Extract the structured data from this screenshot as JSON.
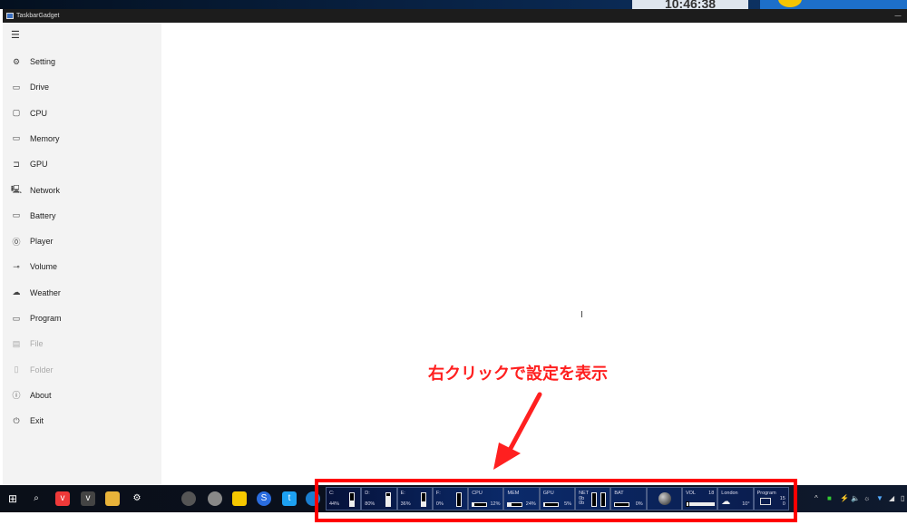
{
  "window": {
    "title": "TaskbarGadget",
    "minimize": "—"
  },
  "desktop": {
    "clock": "10:46:38"
  },
  "sidebar": {
    "menu_icon": "hamburger-icon",
    "items": [
      {
        "label": "Setting",
        "icon": "gear-icon",
        "glyph": "⚙",
        "enabled": true
      },
      {
        "label": "Drive",
        "icon": "drive-icon",
        "glyph": "▭",
        "enabled": true
      },
      {
        "label": "CPU",
        "icon": "cpu-icon",
        "glyph": "▢",
        "enabled": true
      },
      {
        "label": "Memory",
        "icon": "memory-icon",
        "glyph": "▭",
        "enabled": true
      },
      {
        "label": "GPU",
        "icon": "gpu-icon",
        "glyph": "⊐",
        "enabled": true
      },
      {
        "label": "Network",
        "icon": "network-icon",
        "glyph": "🖳",
        "enabled": true
      },
      {
        "label": "Battery",
        "icon": "battery-icon",
        "glyph": "▭",
        "enabled": true
      },
      {
        "label": "Player",
        "icon": "player-icon",
        "glyph": "⓪",
        "enabled": true
      },
      {
        "label": "Volume",
        "icon": "volume-icon",
        "glyph": "⊸",
        "enabled": true
      },
      {
        "label": "Weather",
        "icon": "weather-icon",
        "glyph": "☁",
        "enabled": true
      },
      {
        "label": "Program",
        "icon": "program-icon",
        "glyph": "▭",
        "enabled": true
      },
      {
        "label": "File",
        "icon": "file-icon",
        "glyph": "▤",
        "enabled": false
      },
      {
        "label": "Folder",
        "icon": "folder-icon",
        "glyph": "▯",
        "enabled": false
      },
      {
        "label": "About",
        "icon": "info-icon",
        "glyph": "ⓘ",
        "enabled": true
      },
      {
        "label": "Exit",
        "icon": "power-icon",
        "glyph": "⏻",
        "enabled": true
      }
    ]
  },
  "annotation": "右クリックで設定を表示",
  "gadgets": {
    "drives": [
      {
        "label": "C:",
        "value": "44%",
        "percent": 44
      },
      {
        "label": "D:",
        "value": "80%",
        "percent": 80
      },
      {
        "label": "E:",
        "value": "36%",
        "percent": 36
      },
      {
        "label": "F:",
        "value": "0%",
        "percent": 0
      }
    ],
    "meters": [
      {
        "label": "CPU",
        "value": "12%",
        "percent": 12
      },
      {
        "label": "MEM",
        "value": "24%",
        "percent": 24
      },
      {
        "label": "GPU",
        "value": "5%",
        "percent": 5
      }
    ],
    "net": {
      "label": "NET",
      "up": "0b",
      "down": "0b"
    },
    "bat": {
      "label": "BAT",
      "value": "0%",
      "percent": 0
    },
    "vol": {
      "label": "VOL",
      "value": "18",
      "percent": 18
    },
    "weather": {
      "label": "London",
      "temp": "10°"
    },
    "program": {
      "label": "Program",
      "top": "15",
      "bottom": "0"
    }
  },
  "colors": {
    "highlight": "#ff0000",
    "taskbar": "#0a0f18"
  }
}
